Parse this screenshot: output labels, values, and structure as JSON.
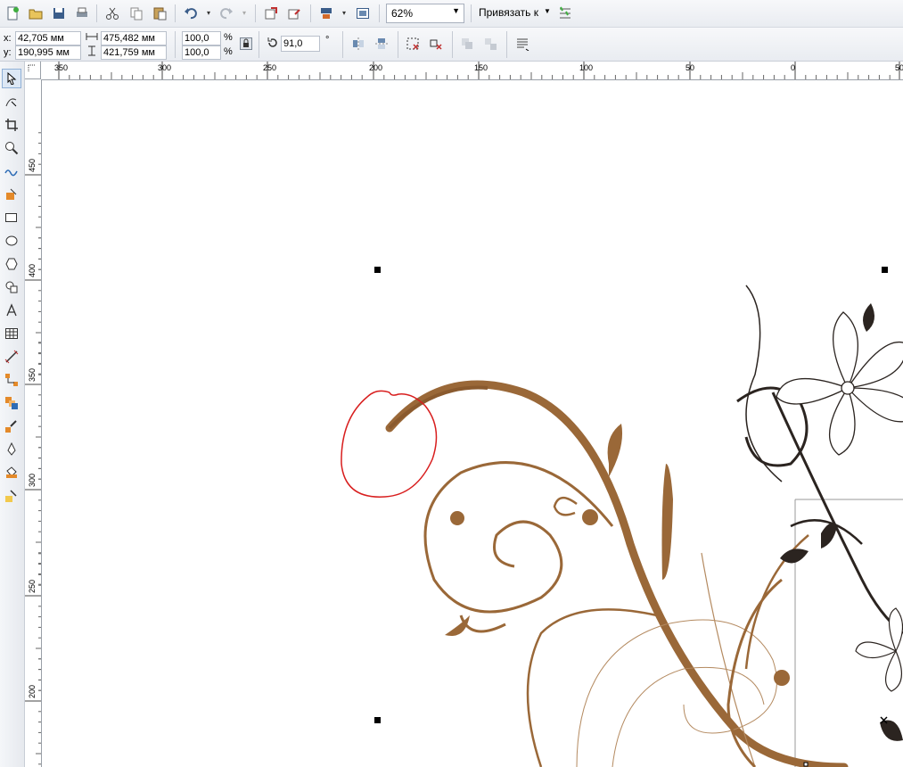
{
  "standard_toolbar": {
    "zoom_value": "62%",
    "snap_label": "Привязать к"
  },
  "property_bar": {
    "x_label": "x:",
    "x_value": "42,705 мм",
    "y_label": "y:",
    "y_value": "190,995 мм",
    "width_value": "475,482 мм",
    "height_value": "421,759 мм",
    "scale_w": "100,0",
    "scale_h": "100,0",
    "percent": "%",
    "rotation": "91,0",
    "degree": "°"
  },
  "rulers": {
    "horizontal_ticks": [
      "350",
      "300",
      "250",
      "200",
      "150",
      "100",
      "50",
      "0",
      "50"
    ],
    "vertical_ticks": [
      "450",
      "400",
      "350",
      "300",
      "250",
      "200"
    ]
  },
  "colors": {
    "accent_brown": "#9a6838",
    "dark_flower": "#2b2420",
    "annotation_red": "#d81e1e",
    "toolbar_bg": "#eef0f4"
  },
  "icons": {
    "toolbox": [
      "pick-tool-icon",
      "shape-tool-icon",
      "crop-tool-icon",
      "zoom-tool-icon",
      "freehand-tool-icon",
      "smart-fill-icon",
      "rectangle-tool-icon",
      "ellipse-tool-icon",
      "polygon-tool-icon",
      "basic-shapes-icon",
      "text-tool-icon",
      "table-tool-icon",
      "dimension-tool-icon",
      "connector-tool-icon",
      "blend-tool-icon",
      "eyedropper-tool-icon",
      "outline-tool-icon",
      "fill-tool-icon",
      "interactive-fill-icon"
    ]
  }
}
